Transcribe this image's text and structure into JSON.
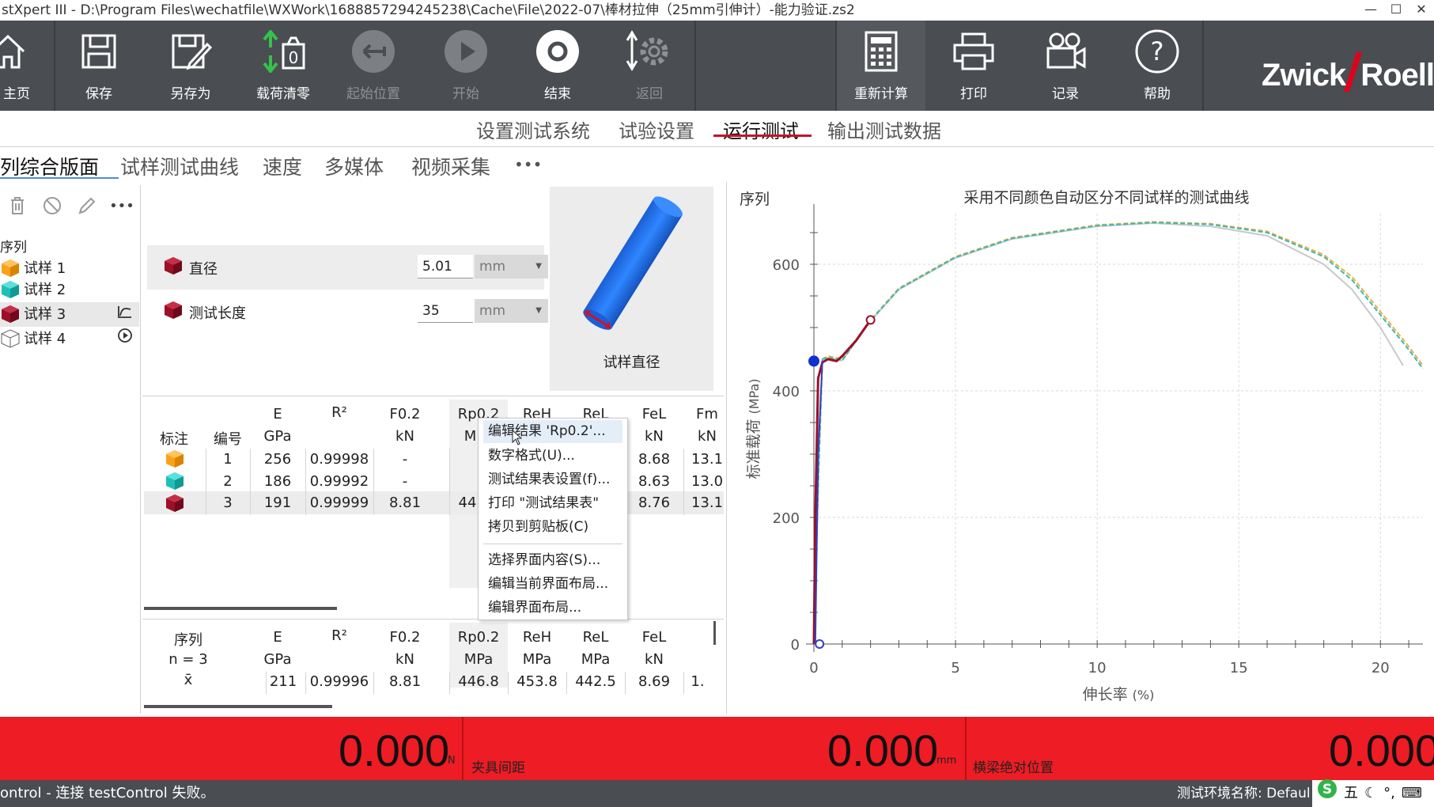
{
  "window": {
    "title": "stXpert III - D:\\Program Files\\wechatfile\\WXWork\\1688857294245238\\Cache\\File\\2022-07\\棒材拉伸（25mm引伸计）-能力验证.zs2",
    "minimize": "—",
    "maximize": "☐",
    "close": "✕"
  },
  "toolbar": {
    "home": "主页",
    "save": "保存",
    "save_as": "另存为",
    "tare": "载荷清零",
    "start_pos": "起始位置",
    "start": "开始",
    "stop": "结束",
    "return": "返回",
    "recalc": "重新计算",
    "print": "打印",
    "record": "记录",
    "help": "帮助",
    "logo_left": "Zwick",
    "logo_right": "Roell"
  },
  "workflow_tabs": [
    "设置测试系统",
    "试验设置",
    "运行测试",
    "输出测试数据"
  ],
  "sub_tabs": [
    "列综合版面",
    "试样测试曲线",
    "速度",
    "多媒体",
    "视频采集",
    "•••"
  ],
  "left_panel": {
    "header": "序列",
    "more": "•••",
    "items": [
      {
        "label": "试样 1",
        "color": "#f7a21b"
      },
      {
        "label": "试样 2",
        "color": "#1fbfb8"
      },
      {
        "label": "试样 3",
        "color": "#9b1027"
      },
      {
        "label": "试样 4",
        "color": "#ffffff"
      }
    ]
  },
  "params": {
    "diameter_label": "直径",
    "diameter_value": "5.01",
    "diameter_unit": "mm",
    "length_label": "测试长度",
    "length_value": "35",
    "length_unit": "mm",
    "specimen_caption": "试样直径"
  },
  "results": {
    "headers": [
      {
        "top": "标注",
        "bottom": ""
      },
      {
        "top": "编号",
        "bottom": ""
      },
      {
        "top": "E",
        "bottom": "GPa"
      },
      {
        "top": "R²",
        "bottom": ""
      },
      {
        "top": "F0.2",
        "bottom": "kN"
      },
      {
        "top": "Rp0.2",
        "bottom": "MPa"
      },
      {
        "top": "ReH",
        "bottom": "MPa"
      },
      {
        "top": "ReL",
        "bottom": "MPa"
      },
      {
        "top": "FeL",
        "bottom": "kN"
      },
      {
        "top": "Fm",
        "bottom": "kN"
      }
    ],
    "rows": [
      {
        "no": "1",
        "E": "256",
        "R2": "0.99998",
        "F02": "-",
        "Rp02": "",
        "ReH": "",
        "ReL": "",
        "FeL": "8.68",
        "Fm": "13.1"
      },
      {
        "no": "2",
        "E": "186",
        "R2": "0.99992",
        "F02": "-",
        "Rp02": "",
        "ReH": "",
        "ReL": "",
        "FeL": "8.63",
        "Fm": "13.0"
      },
      {
        "no": "3",
        "E": "191",
        "R2": "0.99999",
        "F02": "8.81",
        "Rp02": "44",
        "ReH": "",
        "ReL": "",
        "FeL": "8.76",
        "Fm": "13.1"
      }
    ]
  },
  "context_menu": {
    "items": [
      "编辑结果 'Rp0.2'...",
      "数字格式(U)...",
      "测试结果表设置(f)...",
      "打印 \"测试结果表\"",
      "拷贝到剪贴板(C)",
      "选择界面内容(S)...",
      "编辑当前界面布局...",
      "编辑界面布局..."
    ]
  },
  "summary": {
    "series_label": "序列",
    "n_label": "n = 3",
    "mean_label": "x̄",
    "headers": [
      {
        "top": "E",
        "bottom": "GPa"
      },
      {
        "top": "R²",
        "bottom": ""
      },
      {
        "top": "F0.2",
        "bottom": "kN"
      },
      {
        "top": "Rp0.2",
        "bottom": "MPa"
      },
      {
        "top": "ReH",
        "bottom": "MPa"
      },
      {
        "top": "ReL",
        "bottom": "MPa"
      },
      {
        "top": "FeL",
        "bottom": "kN"
      }
    ],
    "values": [
      "211",
      "0.99996",
      "8.81",
      "446.8",
      "453.8",
      "442.5",
      "8.69",
      "1."
    ]
  },
  "chart_data": {
    "type": "line",
    "corner_label": "序列",
    "title": "采用不同颜色自动区分不同试样的测试曲线",
    "xlabel": "伸长率",
    "xunit": "(%)",
    "ylabel": "标准载荷",
    "yunit": "(MPa)",
    "xlim": [
      0,
      21.5
    ],
    "ylim": [
      0,
      680
    ],
    "xticks": [
      0,
      5,
      10,
      15,
      20
    ],
    "yticks": [
      0,
      200,
      400,
      600
    ],
    "grid": true,
    "series": [
      {
        "color": "#c8c8c8",
        "x": [
          0,
          0.15,
          0.3,
          0.5,
          1.0,
          2.0,
          3,
          5,
          7,
          10,
          12,
          14,
          16,
          18,
          19,
          20,
          20.8
        ],
        "y": [
          0,
          250,
          450,
          452,
          448,
          510,
          560,
          610,
          640,
          660,
          665,
          660,
          645,
          600,
          560,
          500,
          440
        ]
      },
      {
        "color": "#e8b040",
        "x": [
          0,
          0.15,
          0.3,
          0.5,
          1.0,
          2.0,
          3,
          5,
          7,
          10,
          12,
          14,
          16,
          18,
          19,
          20,
          21.0,
          21.5
        ],
        "y": [
          0,
          250,
          450,
          455,
          450,
          512,
          562,
          612,
          642,
          662,
          667,
          664,
          652,
          615,
          580,
          525,
          470,
          440
        ]
      },
      {
        "color": "#40b8b0",
        "x": [
          0,
          0.15,
          0.3,
          0.5,
          1.0,
          2.0,
          3,
          5,
          7,
          10,
          12,
          14,
          16,
          18,
          19,
          20,
          21.0,
          21.5
        ],
        "y": [
          0,
          250,
          450,
          453,
          448,
          511,
          561,
          611,
          641,
          661,
          666,
          663,
          650,
          612,
          575,
          520,
          465,
          435
        ]
      },
      {
        "color": "#9b1027",
        "x": [
          0,
          0.05,
          0.15,
          0.3,
          0.5,
          0.8,
          1.0,
          1.5,
          2.0
        ],
        "y": [
          0,
          200,
          420,
          445,
          450,
          447,
          455,
          480,
          512
        ]
      },
      {
        "color": "#3040c0",
        "x": [
          0.05,
          0.15,
          0.3
        ],
        "y": [
          0,
          300,
          448
        ]
      }
    ],
    "markers": [
      {
        "x": 0,
        "y": 447,
        "color": "#1030d0"
      },
      {
        "x": 2.0,
        "y": 512,
        "color": "#9b1027"
      },
      {
        "x": 0.2,
        "y": 0,
        "color": "#3040c0"
      }
    ]
  },
  "readout": {
    "force_value": "0.000",
    "force_unit": "N",
    "grip_label": "夹具间距",
    "grip_value": "0.000",
    "grip_unit": "mm",
    "crosshead_label": "横梁绝对位置",
    "crosshead_value": "0.000"
  },
  "status": {
    "message": "ontrol - 连接 testControl 失败。",
    "env": "测试环境名称: Defaul",
    "ime_label": "五"
  },
  "colors": {
    "toolbar_bg": "#4a4d52",
    "accent_red": "#ee1c24",
    "active_tab_underline": "#c8102e"
  }
}
